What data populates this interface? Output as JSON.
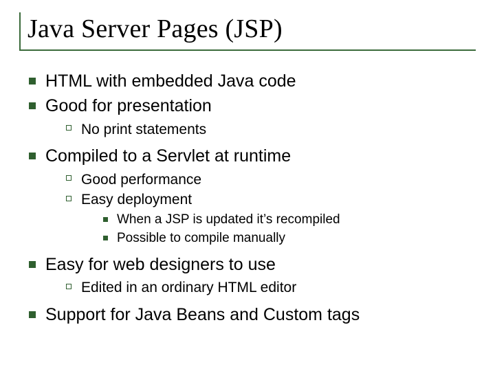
{
  "title": "Java Server Pages (JSP)",
  "b1": "HTML with embedded Java code",
  "b2": "Good for presentation",
  "b2a": "No print statements",
  "b3": "Compiled to a Servlet at runtime",
  "b3a": "Good performance",
  "b3b": "Easy deployment",
  "b3b1": "When a JSP is updated it’s recompiled",
  "b3b2": "Possible to compile manually",
  "b4": "Easy for web designers to use",
  "b4a": "Edited in an ordinary HTML editor",
  "b5": "Support for Java Beans and Custom tags"
}
